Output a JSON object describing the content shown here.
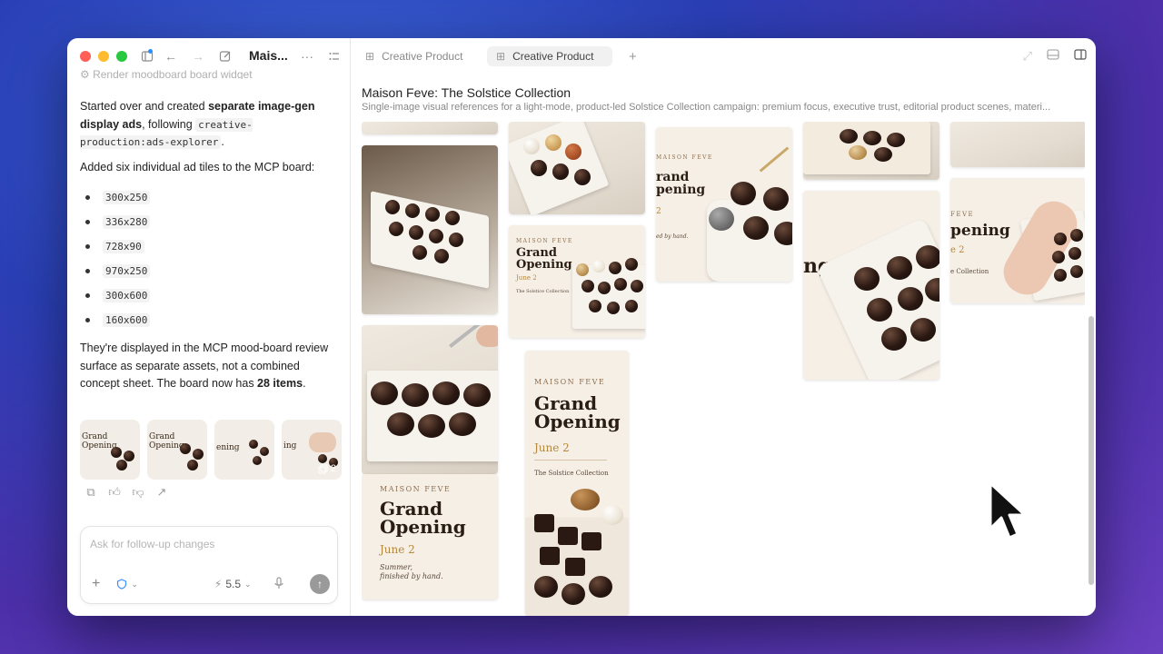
{
  "left_pane": {
    "window_title": "Mais...",
    "cut_line": "Render moodboard board widget",
    "message": {
      "p1_a": "Started over and created ",
      "p1_bold": "separate image-gen display ads",
      "p1_b": ", following ",
      "p1_code": "creative-production:ads-explorer",
      "p1_c": ".",
      "p2": "Added six individual ad tiles to the MCP board:",
      "sizes": [
        "300x250",
        "336x280",
        "728x90",
        "970x250",
        "300x600",
        "160x600"
      ],
      "p3_a": "They're displayed in the MCP mood-board review surface as separate assets, not a combined concept sheet. The board now has ",
      "p3_bold": "28 items",
      "p3_b": "."
    },
    "thumbnails": [
      {
        "text": "Grand\nOpening"
      },
      {
        "text": "Grand\nOpening"
      },
      {
        "text": "ening"
      },
      {
        "text": "ing",
        "badge": "2"
      }
    ],
    "composer": {
      "placeholder": "Ask for follow-up changes",
      "model": "5.5"
    }
  },
  "right_pane": {
    "tabs": [
      {
        "label": "Creative Product",
        "active": false
      },
      {
        "label": "Creative Product",
        "active": true
      }
    ],
    "board_title": "Maison Feve: The Solstice Collection",
    "board_subtitle": "Single-image visual references for a light-mode, product-led Solstice Collection campaign: premium focus, executive trust, editorial product scenes, materi...",
    "ads": {
      "brand": "MAISON FEVE",
      "headline": "Grand Opening",
      "date": "June 2",
      "collection": "The Solstice Collection",
      "tagline": "Summer, finished by hand.",
      "partial_headline_1": "rand\npening",
      "partial_date_1": "2",
      "partial_tag_1": "ed by hand.",
      "partial_headline_2": "ng",
      "partial_brand_3": "FEVE",
      "partial_headline_3": "pening",
      "partial_date_3": "e 2",
      "partial_col_3": "e Collection"
    }
  },
  "colors": {
    "traffic_red": "#ff5f57",
    "traffic_yellow": "#febc2e",
    "traffic_green": "#28c840",
    "accent_gold": "#b5893e",
    "chocolate": "#2a1812"
  }
}
